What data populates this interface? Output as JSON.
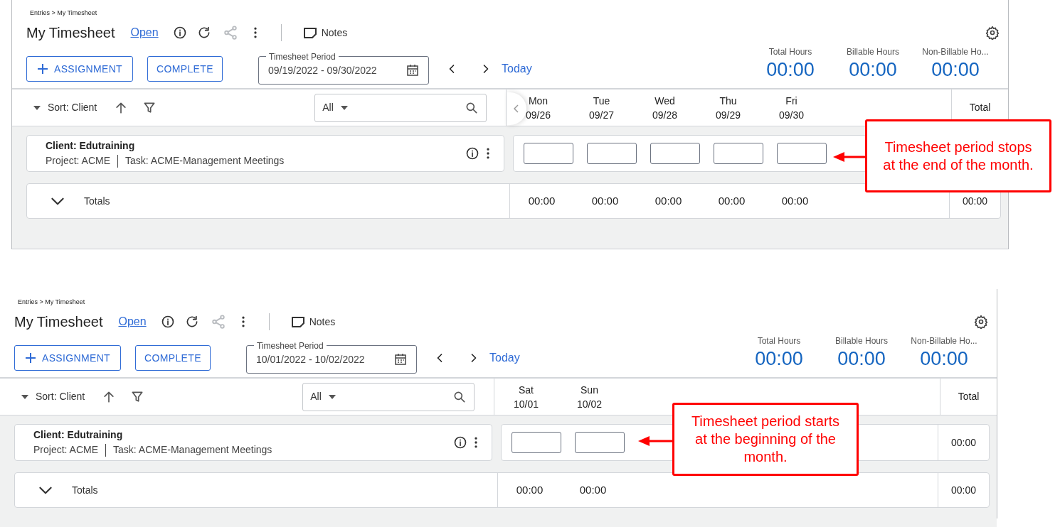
{
  "panels": [
    {
      "breadcrumb": "Entries > My Timesheet",
      "title": "My Timesheet",
      "status": "Open",
      "notes": "Notes",
      "buttons": [
        "ASSIGNMENT",
        "COMPLETE"
      ],
      "period": {
        "label": "Timesheet Period",
        "value": "09/19/2022 - 09/30/2022"
      },
      "today": "Today",
      "stats": [
        {
          "label": "Total Hours",
          "value": "00:00"
        },
        {
          "label": "Billable Hours",
          "value": "00:00"
        },
        {
          "label": "Non-Billable Ho...",
          "value": "00:00"
        }
      ],
      "sort": "Sort: Client",
      "filter": "All",
      "scroll_tab": true,
      "days": [
        {
          "day": "Mon",
          "date": "09/26"
        },
        {
          "day": "Tue",
          "date": "09/27"
        },
        {
          "day": "Wed",
          "date": "09/28"
        },
        {
          "day": "Thu",
          "date": "09/29"
        },
        {
          "day": "Fri",
          "date": "09/30"
        }
      ],
      "total_header": "Total",
      "row": {
        "client": "Client: Edutraining",
        "project": "Project: ACME",
        "task": "Task: ACME-Management Meetings"
      },
      "totals": {
        "label": "Totals",
        "days": [
          "00:00",
          "00:00",
          "00:00",
          "00:00",
          "00:00"
        ],
        "total": "00:00"
      },
      "callout": "Timesheet period stops at the end of the month."
    },
    {
      "breadcrumb": "Entries > My Timesheet",
      "title": "My Timesheet",
      "status": "Open",
      "notes": "Notes",
      "buttons": [
        "ASSIGNMENT",
        "COMPLETE"
      ],
      "period": {
        "label": "Timesheet Period",
        "value": "10/01/2022 - 10/02/2022"
      },
      "today": "Today",
      "stats": [
        {
          "label": "Total Hours",
          "value": "00:00"
        },
        {
          "label": "Billable Hours",
          "value": "00:00"
        },
        {
          "label": "Non-Billable Ho...",
          "value": "00:00"
        }
      ],
      "sort": "Sort: Client",
      "filter": "All",
      "scroll_tab": false,
      "days": [
        {
          "day": "Sat",
          "date": "10/01"
        },
        {
          "day": "Sun",
          "date": "10/02"
        }
      ],
      "total_header": "Total",
      "row": {
        "client": "Client: Edutraining",
        "project": "Project: ACME",
        "task": "Task: ACME-Management Meetings",
        "total": "00:00"
      },
      "totals": {
        "label": "Totals",
        "days": [
          "00:00",
          "00:00"
        ],
        "total": "00:00"
      },
      "callout": "Timesheet period starts at the beginning of the month."
    }
  ]
}
